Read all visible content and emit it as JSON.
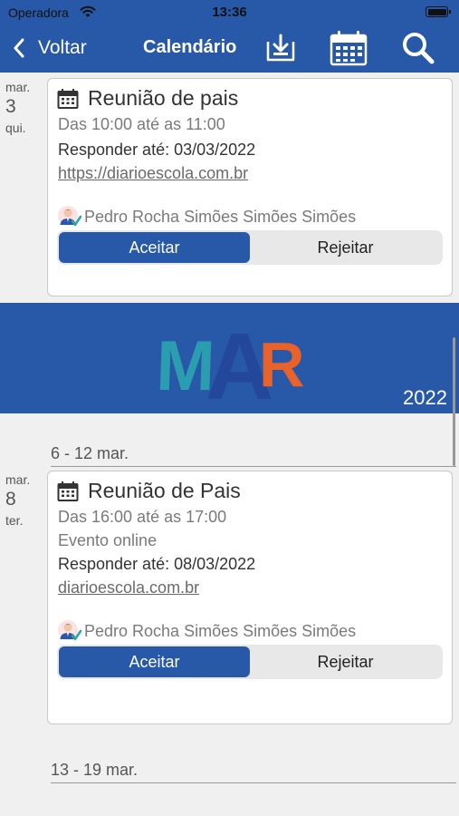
{
  "status_bar": {
    "carrier": "Operadora",
    "time": "13:36"
  },
  "nav": {
    "back_label": "Voltar",
    "title": "Calendário",
    "icons": [
      "download-icon",
      "calendar-icon",
      "search-icon"
    ]
  },
  "month_banner": {
    "month": "MAR",
    "year": "2022"
  },
  "weeks": [
    "6 - 12 mar.",
    "13 - 19 mar."
  ],
  "events": [
    {
      "day": {
        "month": "mar.",
        "date": "3",
        "weekday": "qui."
      },
      "title": "Reunião de pais",
      "time": "Das 10:00 até as 11:00",
      "respond_by": "Responder até: 03/03/2022",
      "link": "https://diarioescola.com.br",
      "person": "Pedro Rocha Simões Simões Simões",
      "accept_label": "Aceitar",
      "reject_label": "Rejeitar",
      "selected": "Aceitar"
    },
    {
      "day": {
        "month": "mar.",
        "date": "8",
        "weekday": "ter."
      },
      "title": "Reunião de Pais",
      "time": "Das 16:00 até as 17:00",
      "location": "Evento online",
      "respond_by": "Responder até: 08/03/2022",
      "link": "diarioescola.com.br",
      "person": "Pedro Rocha Simões Simões Simões",
      "accept_label": "Aceitar",
      "reject_label": "Rejeitar",
      "selected": "Aceitar"
    }
  ],
  "colors": {
    "brand_blue": "#2858a8",
    "banner_teal": "#2a9db0",
    "banner_orange": "#e8622a",
    "banner_dark_blue": "#23479a"
  }
}
